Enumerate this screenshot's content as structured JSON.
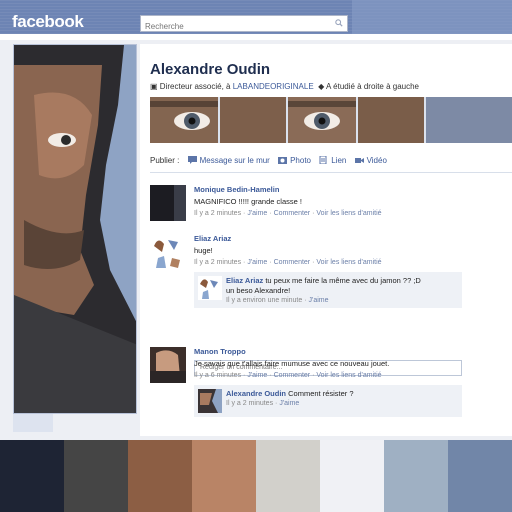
{
  "header": {
    "logo": "facebook",
    "search_placeholder": "Recherche"
  },
  "profile": {
    "name": "Alexandre Oudin",
    "job_prefix": "Directeur associé, à",
    "job_company": "LABANDEORIGINALE",
    "studied": "A étudié à droite à gauche"
  },
  "publisher": {
    "label": "Publier :",
    "items": [
      "Message sur le mur",
      "Photo",
      "Lien",
      "Vidéo"
    ]
  },
  "posts": [
    {
      "name": "Monique Bedin-Hamelin",
      "text": "MAGNIFICO !!!!! grande classe !",
      "time": "Il y a 2 minutes",
      "actions": [
        "J'aime",
        "Commenter",
        "Voir les liens d'amitié"
      ]
    },
    {
      "name": "Eliaz Ariaz",
      "text": "huge!",
      "time": "Il y a 2 minutes",
      "actions": [
        "J'aime",
        "Commenter",
        "Voir les liens d'amitié"
      ],
      "reply": {
        "name": "Eliaz Ariaz",
        "text1": "tu peux me faire la même avec du jamon ?? ;D",
        "text2": "un beso Alexandre!",
        "time": "Il y a environ une minute",
        "action": "J'aime"
      },
      "comment_placeholder": "Rédiger un commentaire..."
    },
    {
      "name": "Manon Troppo",
      "text": "Je savais que t'allais faire mumuse avec ce nouveau jouet.",
      "time": "Il y a 6 minutes",
      "actions": [
        "J'aime",
        "Commenter",
        "Voir les liens d'amitié"
      ],
      "reply": {
        "name": "Alexandre Oudin",
        "text1": "Comment résister ?",
        "time": "Il y a 2 minutes",
        "action": "J'aime"
      }
    }
  ],
  "palette": [
    "#1e2434",
    "#454545",
    "#8c5e44",
    "#b98466",
    "#d2d0cb",
    "#f0f1f5",
    "#9fb0c3",
    "#7186a8"
  ]
}
